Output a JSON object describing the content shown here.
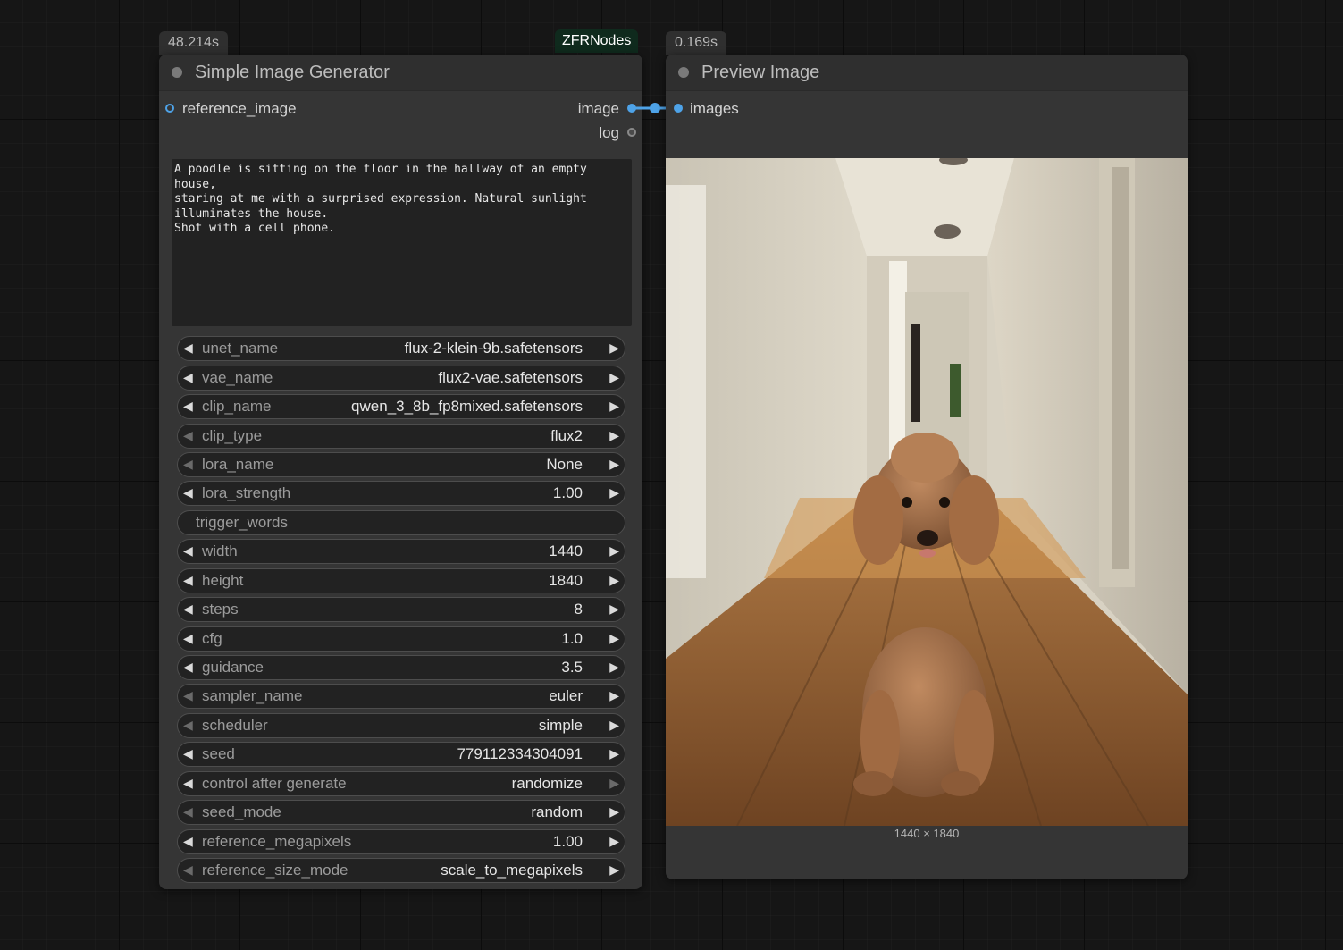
{
  "left_node": {
    "time_badge": "48.214s",
    "title": "Simple Image Generator",
    "input_label": "reference_image",
    "output_image_label": "image",
    "output_log_label": "log",
    "prompt": "A poodle is sitting on the floor in the hallway of an empty house,\nstaring at me with a surprised expression. Natural sunlight\nilluminates the house.\nShot with a cell phone.",
    "widgets": [
      {
        "name": "unet_name",
        "value": "flux-2-klein-9b.safetensors"
      },
      {
        "name": "vae_name",
        "value": "flux2-vae.safetensors"
      },
      {
        "name": "clip_name",
        "value": "qwen_3_8b_fp8mixed.safetensors"
      },
      {
        "name": "clip_type",
        "value": "flux2"
      },
      {
        "name": "lora_name",
        "value": "None"
      },
      {
        "name": "lora_strength",
        "value": "1.00"
      },
      {
        "name": "trigger_words",
        "value": ""
      },
      {
        "name": "width",
        "value": "1440"
      },
      {
        "name": "height",
        "value": "1840"
      },
      {
        "name": "steps",
        "value": "8"
      },
      {
        "name": "cfg",
        "value": "1.0"
      },
      {
        "name": "guidance",
        "value": "3.5"
      },
      {
        "name": "sampler_name",
        "value": "euler"
      },
      {
        "name": "scheduler",
        "value": "simple"
      },
      {
        "name": "seed",
        "value": "779112334304091"
      },
      {
        "name": "control after generate",
        "value": "randomize"
      },
      {
        "name": "seed_mode",
        "value": "random"
      },
      {
        "name": "reference_megapixels",
        "value": "1.00"
      },
      {
        "name": "reference_size_mode",
        "value": "scale_to_megapixels"
      }
    ]
  },
  "group_badge": "ZFRNodes",
  "right_node": {
    "time_badge": "0.169s",
    "title": "Preview Image",
    "input_label": "images",
    "image_dims": "1440 × 1840"
  },
  "icons": {
    "decrement": "triangle-left-icon",
    "increment": "triangle-right-icon"
  },
  "colors": {
    "link": "#4ea3e8",
    "node_bg": "#353535",
    "title_bg": "#2f2f2f",
    "group_badge_bg": "#0f2a1d"
  }
}
